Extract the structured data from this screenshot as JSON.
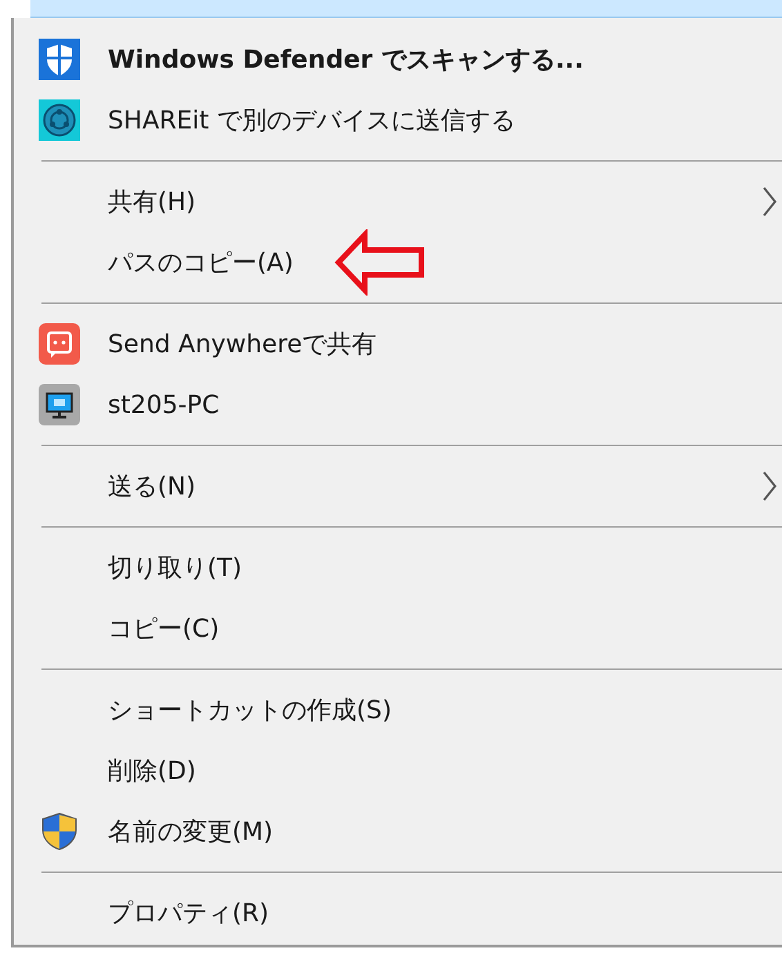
{
  "menu": {
    "items": [
      {
        "kind": "icon-item",
        "label": "Windows Defender でスキャンする...",
        "bold": true,
        "submenu": false,
        "annotated": false
      },
      {
        "kind": "icon-item",
        "label": "SHAREit で別のデバイスに送信する",
        "bold": false,
        "submenu": false,
        "annotated": false
      },
      {
        "kind": "separator"
      },
      {
        "kind": "item",
        "label": "共有(H)",
        "bold": false,
        "submenu": true,
        "annotated": false
      },
      {
        "kind": "item",
        "label": "パスのコピー(A)",
        "bold": false,
        "submenu": false,
        "annotated": true
      },
      {
        "kind": "separator"
      },
      {
        "kind": "icon-item",
        "label": "Send Anywhereで共有",
        "bold": false,
        "submenu": false,
        "annotated": false
      },
      {
        "kind": "icon-item",
        "label": "st205-PC",
        "bold": false,
        "submenu": false,
        "annotated": false
      },
      {
        "kind": "separator"
      },
      {
        "kind": "item",
        "label": "送る(N)",
        "bold": false,
        "submenu": true,
        "annotated": false
      },
      {
        "kind": "separator"
      },
      {
        "kind": "item",
        "label": "切り取り(T)",
        "bold": false,
        "submenu": false,
        "annotated": false
      },
      {
        "kind": "item",
        "label": "コピー(C)",
        "bold": false,
        "submenu": false,
        "annotated": false
      },
      {
        "kind": "separator"
      },
      {
        "kind": "item",
        "label": "ショートカットの作成(S)",
        "bold": false,
        "submenu": false,
        "annotated": false
      },
      {
        "kind": "item",
        "label": "削除(D)",
        "bold": false,
        "submenu": false,
        "annotated": false
      },
      {
        "kind": "icon-item",
        "label": "名前の変更(M)",
        "bold": false,
        "submenu": false,
        "annotated": false
      },
      {
        "kind": "separator"
      },
      {
        "kind": "item",
        "label": "プロパティ(R)",
        "bold": false,
        "submenu": false,
        "annotated": false
      }
    ]
  }
}
